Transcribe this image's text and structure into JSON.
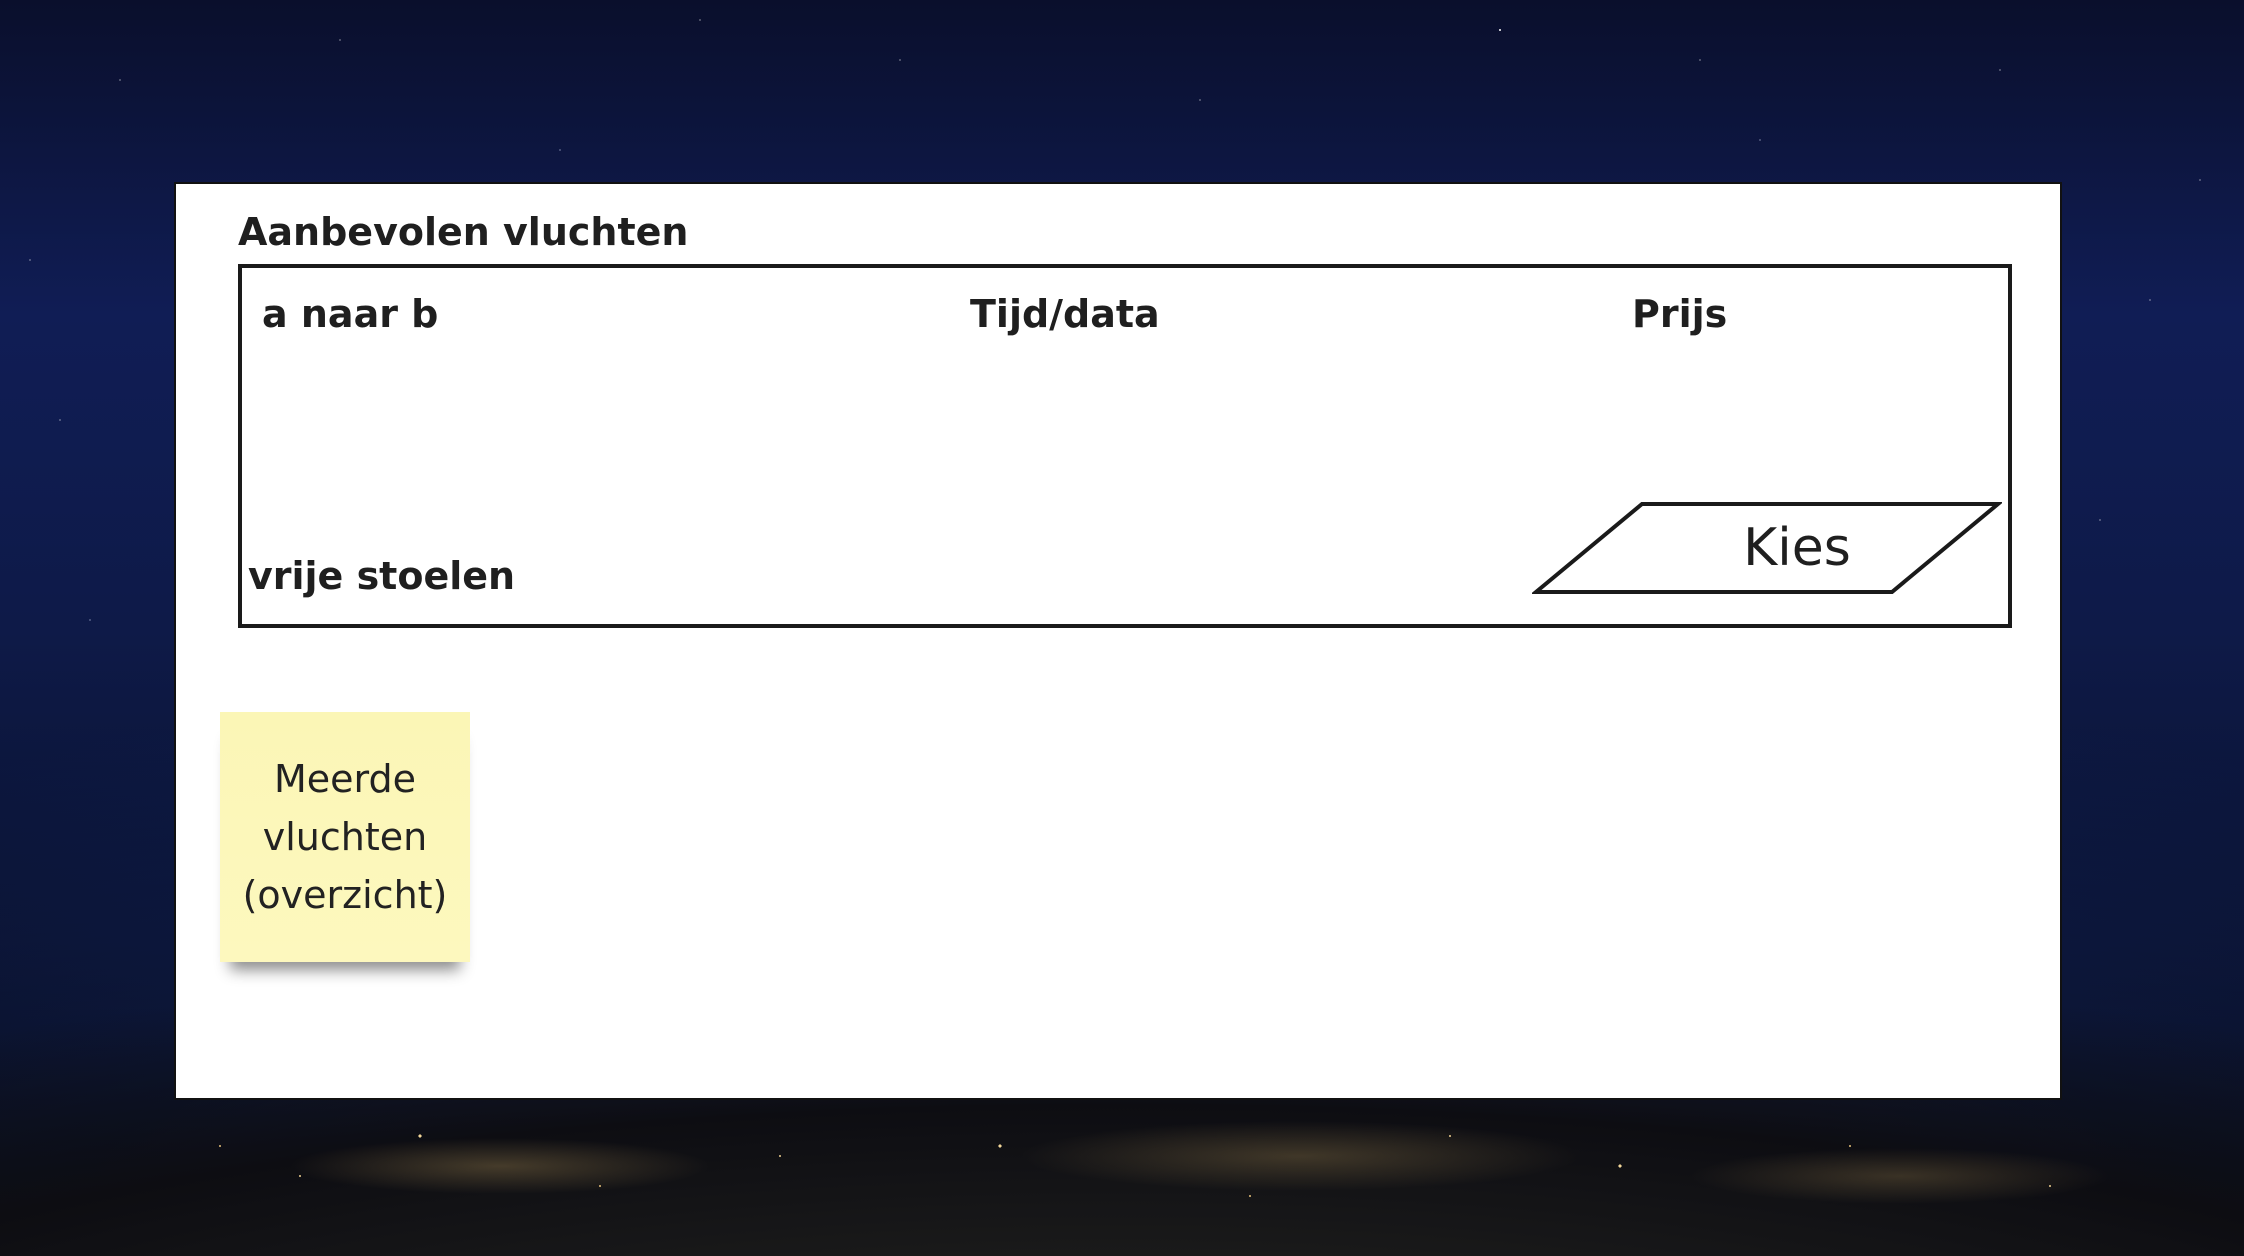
{
  "panel": {
    "title": "Aanbevolen vluchten"
  },
  "flight_card": {
    "columns": {
      "route": "a naar b",
      "time": "Tijd/data",
      "price": "Prijs"
    },
    "seats_label": "vrije stoelen",
    "choose_button_label": "Kies"
  },
  "sticky_note": {
    "text": "Meerde\nvluchten\n(overzicht)"
  }
}
